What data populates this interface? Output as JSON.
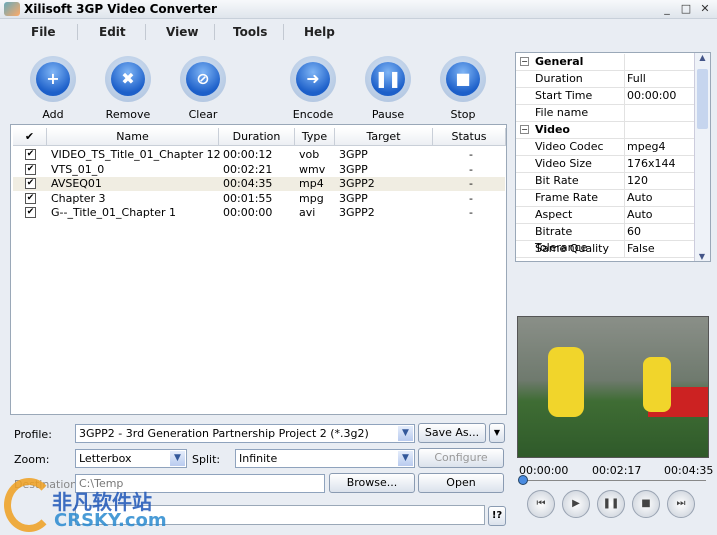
{
  "app": {
    "title": "Xilisoft 3GP Video Converter",
    "min": "_",
    "max": "□",
    "close": "✕"
  },
  "menu": [
    "File",
    "Edit",
    "View",
    "Tools",
    "Help"
  ],
  "toolbar": [
    {
      "label": "Add",
      "glyph": "+"
    },
    {
      "label": "Remove",
      "glyph": "✖"
    },
    {
      "label": "Clear",
      "glyph": "⊘"
    },
    {
      "label": "Encode",
      "glyph": "➜"
    },
    {
      "label": "Pause",
      "glyph": "❚❚"
    },
    {
      "label": "Stop",
      "glyph": "■"
    }
  ],
  "list": {
    "columns": [
      "✔",
      "Name",
      "Duration",
      "Type",
      "Target",
      "Status"
    ],
    "rows": [
      {
        "checked": "✔",
        "name": "VIDEO_TS_Title_01_Chapter 12",
        "duration": "00:00:12",
        "type": "vob",
        "target": "3GPP",
        "status": "-"
      },
      {
        "checked": "✔",
        "name": "VTS_01_0",
        "duration": "00:02:21",
        "type": "wmv",
        "target": "3GPP",
        "status": "-"
      },
      {
        "checked": "✔",
        "name": "AVSEQ01",
        "duration": "00:04:35",
        "type": "mp4",
        "target": "3GPP2",
        "status": "-"
      },
      {
        "checked": "✔",
        "name": "Chapter 3",
        "duration": "00:01:55",
        "type": "mpg",
        "target": "3GPP",
        "status": "-"
      },
      {
        "checked": "✔",
        "name": "G--_Title_01_Chapter 1",
        "duration": "00:00:00",
        "type": "avi",
        "target": "3GPP2",
        "status": "-"
      }
    ]
  },
  "settings": {
    "profile_label": "Profile:",
    "profile": "3GPP2 - 3rd Generation Partnership Project 2  (*.3g2)",
    "save_as": "Save As...",
    "zoom_label": "Zoom:",
    "zoom": "Letterbox",
    "split_label": "Split:",
    "split": "Infinite",
    "configure": "Configure",
    "dest_label": "Destination:",
    "dest": "C:\\Temp",
    "browse": "Browse...",
    "open": "Open",
    "help": "!?"
  },
  "props": [
    {
      "group": true,
      "k": "General",
      "v": ""
    },
    {
      "k": "Duration",
      "v": "Full"
    },
    {
      "k": "Start Time",
      "v": "00:00:00"
    },
    {
      "k": "File name",
      "v": ""
    },
    {
      "group": true,
      "k": "Video",
      "v": ""
    },
    {
      "k": "Video Codec",
      "v": "mpeg4"
    },
    {
      "k": "Video Size",
      "v": "176x144"
    },
    {
      "k": "Bit Rate",
      "v": "120"
    },
    {
      "k": "Frame Rate",
      "v": "Auto"
    },
    {
      "k": "Aspect",
      "v": "Auto"
    },
    {
      "k": "Bitrate Tolerance",
      "v": "60"
    },
    {
      "k": "Same Quality",
      "v": "False"
    }
  ],
  "player": {
    "start": "00:00:00",
    "mid": "00:02:17",
    "end": "00:04:35",
    "position": 0,
    "controls": [
      "⏮",
      "▶",
      "❚❚",
      "■",
      "⏭"
    ]
  },
  "watermark": {
    "cn": "非凡软件站",
    "en": "CRSKY.com"
  }
}
